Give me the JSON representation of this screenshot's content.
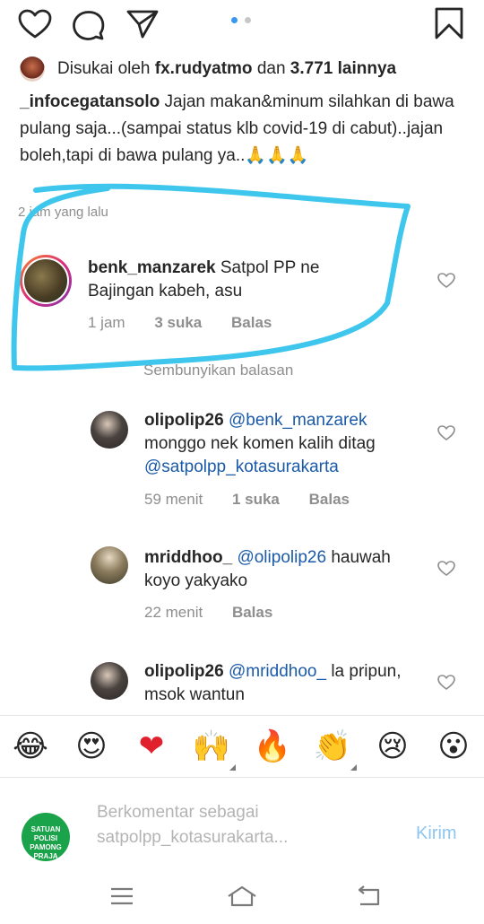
{
  "post": {
    "pager": {
      "active_color": "#3897f0",
      "inactive_color": "#c7c7c7"
    },
    "likes": {
      "prefix": "Disukai oleh",
      "user": "fx.rudyatmo",
      "middle": "dan",
      "count": "3.771 lainnya"
    },
    "caption": {
      "user": "_infocegatansolo",
      "text": "Jajan makan&minum silahkan di bawa pulang saja...(sampai status klb covid-19 di cabut)..jajan boleh,tapi di bawa pulang ya..🙏🙏🙏"
    },
    "timestamp": "2 jam yang lalu"
  },
  "comments": [
    {
      "user": "benk_manzarek",
      "mention": "",
      "text": "Satpol PP ne Bajingan kabeh, asu",
      "time": "1 jam",
      "likes": "3 suka",
      "reply": "Balas"
    }
  ],
  "hide_replies": "Sembunyikan balasan",
  "replies": [
    {
      "user": "olipolip26",
      "mention": "@benk_manzarek",
      "text": "monggo nek komen kalih ditag",
      "mention2": "@satpolpp_kotasurakarta",
      "time": "59 menit",
      "likes": "1 suka",
      "reply": "Balas"
    },
    {
      "user": "mriddhoo_",
      "mention": "@olipolip26",
      "text": "hauwah koyo yakyako",
      "time": "22 menit",
      "reply": "Balas"
    },
    {
      "user": "olipolip26",
      "mention": "@mriddhoo_",
      "text": "la pripun, msok wantun"
    }
  ],
  "emojis": [
    "😂",
    "😍",
    "❤",
    "🙌",
    "🔥",
    "👏",
    "😢",
    "😮"
  ],
  "compose": {
    "avatar_text": "SATUAN POLISI PAMONG PRAJA",
    "placeholder": "Berkomentar sebagai satpolpp_kotasurakarta...",
    "send_label": "Kirim"
  },
  "annotation_color": "#3fc6ec"
}
